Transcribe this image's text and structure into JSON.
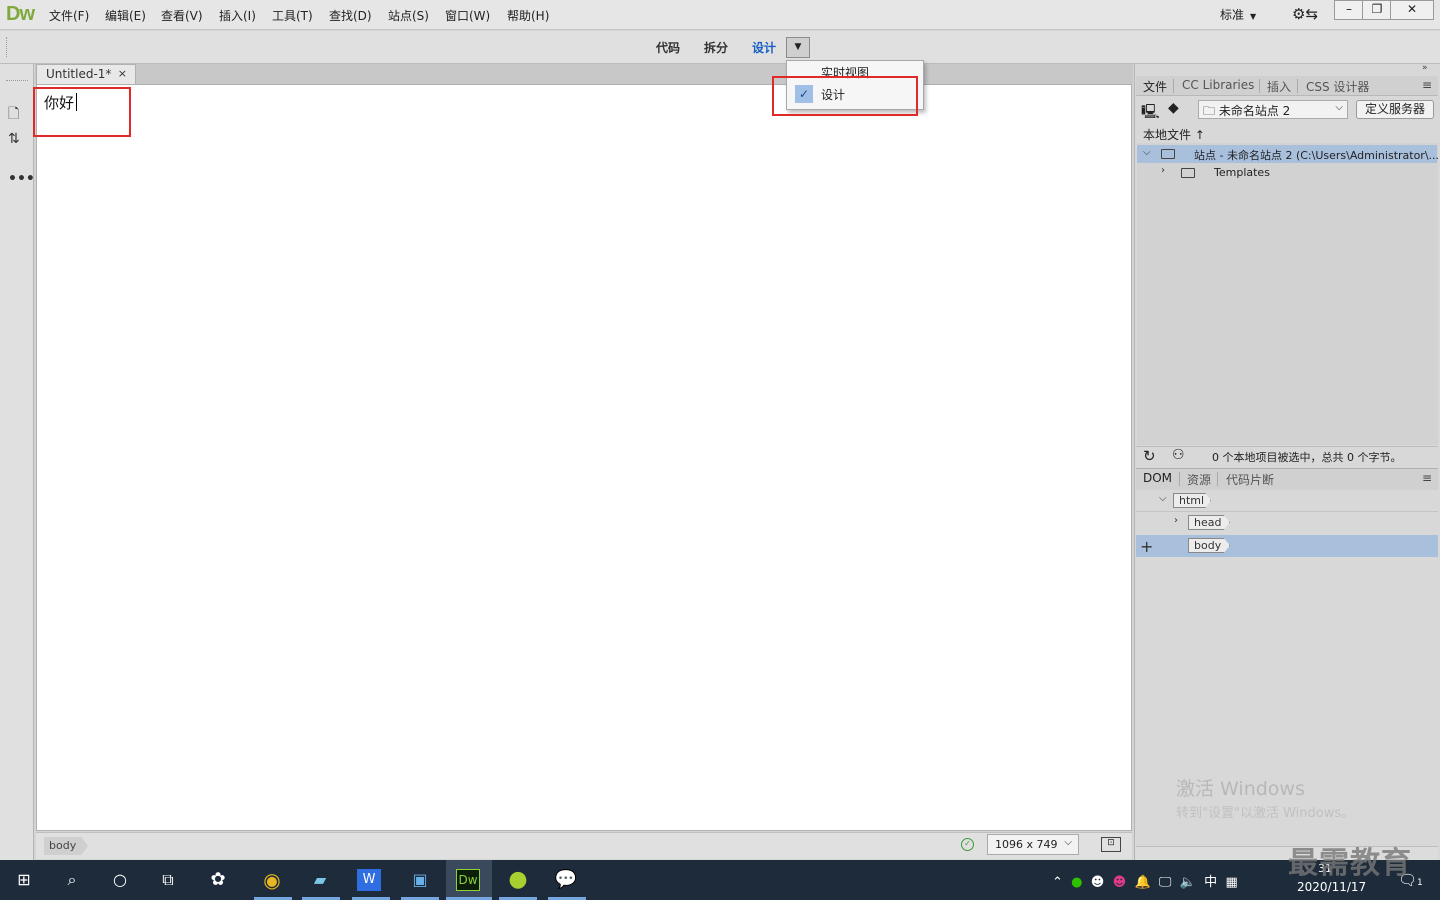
{
  "app": {
    "logo": "Dw"
  },
  "menu": [
    "文件(F)",
    "编辑(E)",
    "查看(V)",
    "插入(I)",
    "工具(T)",
    "查找(D)",
    "站点(S)",
    "窗口(W)",
    "帮助(H)"
  ],
  "workspace": {
    "label": "标准"
  },
  "window_controls": {
    "minimize": "–",
    "restore": "❐",
    "close": "✕"
  },
  "view_buttons": {
    "code": "代码",
    "split": "拆分",
    "design": "设计"
  },
  "accent_color": "#1a5fc4",
  "highlight_color": "#e02a2a",
  "view_dropdown": {
    "live": "实时视图",
    "design": "设计",
    "design_checked": true
  },
  "doc_tab": {
    "title": "Untitled-1*",
    "close": "×"
  },
  "canvas": {
    "text": "你好"
  },
  "status": {
    "tag": "body",
    "size": "1096 x 749"
  },
  "files_panel": {
    "tabs": [
      "文件",
      "CC Libraries",
      "插入",
      "CSS 设计器"
    ],
    "site": "未命名站点 2",
    "define_server": "定义服务器",
    "local_files": "本地文件",
    "tree": [
      {
        "label": "站点 - 未命名站点 2 (C:\\Users\\Administrator\\..."
      },
      {
        "label": "Templates"
      }
    ],
    "footer_status": "0 个本地项目被选中，总共 0 个字节。"
  },
  "dom_panel": {
    "tabs": [
      "DOM",
      "资源",
      "代码片断"
    ],
    "nodes": [
      "html",
      "head",
      "body"
    ]
  },
  "watermark": {
    "line1": "激活 Windows",
    "line2": "转到\"设置\"以激活 Windows。"
  },
  "brand_watermark": "最需教育",
  "taskbar": {
    "tray_lang": "中",
    "time": "31",
    "date": "2020/11/17",
    "notif_count": "1"
  }
}
